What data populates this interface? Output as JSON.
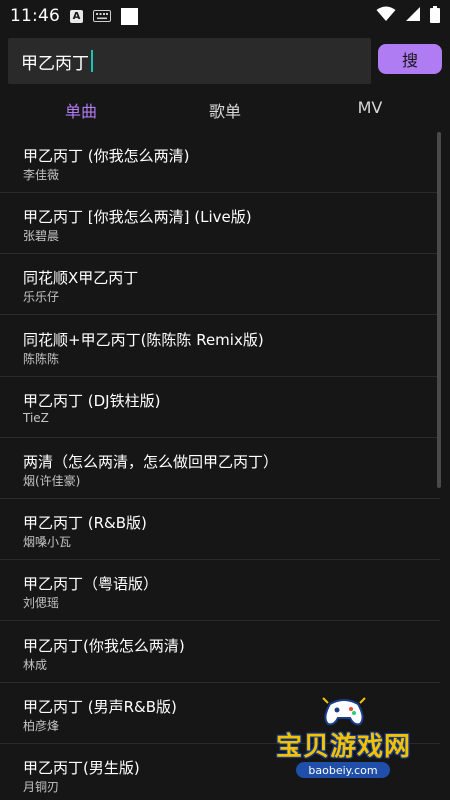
{
  "status_bar": {
    "time": "11:46",
    "a_badge": "A",
    "icons": [
      "notification-a-icon",
      "keyboard-icon",
      "square-icon",
      "wifi-icon",
      "signal-icon",
      "battery-icon"
    ]
  },
  "search": {
    "value": "甲乙丙丁",
    "button_label": "搜"
  },
  "tabs": [
    {
      "label": "单曲",
      "active": true
    },
    {
      "label": "歌单",
      "active": false
    },
    {
      "label": "MV",
      "active": false
    }
  ],
  "songs": [
    {
      "title": "甲乙丙丁 (你我怎么两清)",
      "artist": "李佳薇"
    },
    {
      "title": "甲乙丙丁 [你我怎么两清] (Live版)",
      "artist": "张碧晨"
    },
    {
      "title": "同花顺X甲乙丙丁",
      "artist": "乐乐仔"
    },
    {
      "title": "同花顺+甲乙丙丁(陈陈陈 Remix版)",
      "artist": "陈陈陈"
    },
    {
      "title": "甲乙丙丁 (DJ铁柱版)",
      "artist": "TieZ"
    },
    {
      "title": "两清（怎么两清，怎么做回甲乙丙丁）",
      "artist": "烟(许佳豪)"
    },
    {
      "title": "甲乙丙丁 (R&B版)",
      "artist": "烟嗓小瓦"
    },
    {
      "title": "甲乙丙丁（粤语版）",
      "artist": "刘偲瑶"
    },
    {
      "title": "甲乙丙丁(你我怎么两清)",
      "artist": "林成"
    },
    {
      "title": "甲乙丙丁 (男声R&B版)",
      "artist": "柏彦烽"
    },
    {
      "title": "甲乙丙丁(男生版)",
      "artist": "月铜刃"
    }
  ],
  "watermark": {
    "text": "宝贝游戏网",
    "url": "baobeiy.com"
  },
  "colors": {
    "background": "#161616",
    "accent": "#b07cf3",
    "caret": "#14c6b4"
  }
}
